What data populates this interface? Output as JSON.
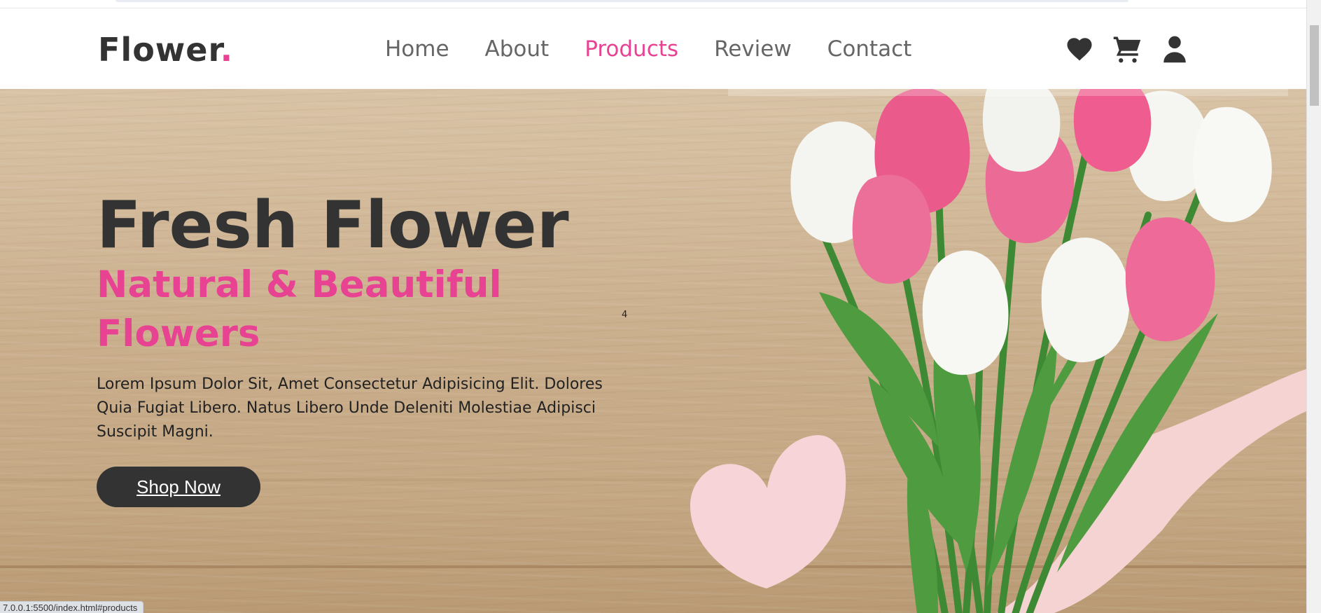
{
  "header": {
    "logo_text": "Flower",
    "logo_dot": ".",
    "nav": [
      {
        "label": "Home"
      },
      {
        "label": "About"
      },
      {
        "label": "Products"
      },
      {
        "label": "Review"
      },
      {
        "label": "Contact"
      }
    ],
    "active_nav": "Products",
    "icons": [
      "heart-icon",
      "shopping-cart-icon",
      "user-icon"
    ]
  },
  "hero": {
    "title": "Fresh Flower",
    "subtitle": "Natural & Beautiful Flowers",
    "description": "Lorem Ipsum Dolor Sit, Amet Consectetur Adipisicing Elit. Dolores Quia Fugiat Libero. Natus Libero Unde Deleniti Molestiae Adipisci Suscipit Magni.",
    "superscript": "4",
    "cta_label": "Shop Now"
  },
  "status_bar": {
    "url": "7.0.0.1:5500/index.html#products"
  },
  "colors": {
    "accent": "#e84393",
    "dark": "#333333",
    "nav_text": "#666666"
  }
}
